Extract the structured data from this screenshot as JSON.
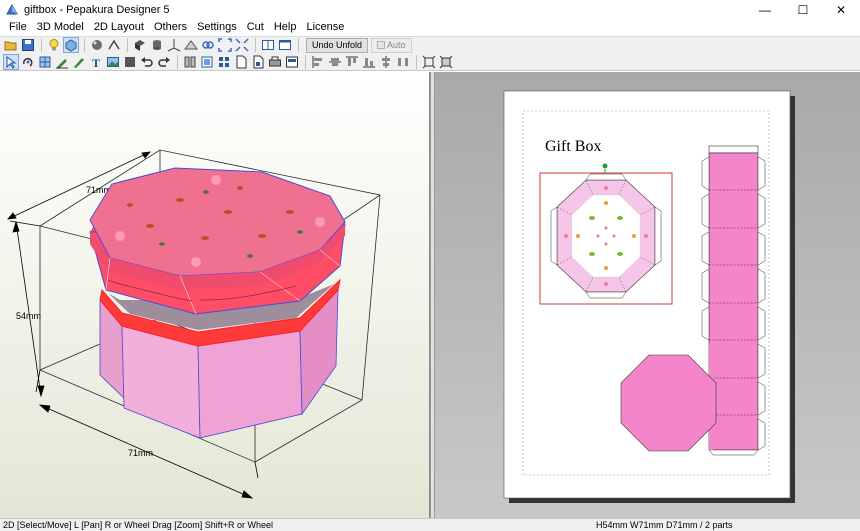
{
  "window": {
    "title": "giftbox - Pepakura Designer 5",
    "minimize_glyph": "—",
    "maximize_glyph": "☐",
    "close_glyph": "✕"
  },
  "menu": [
    "File",
    "3D Model",
    "2D Layout",
    "Others",
    "Settings",
    "Cut",
    "Help",
    "License"
  ],
  "toolbar1": {
    "undo_unfold_label": "Undo Unfold",
    "auto_label": "Auto",
    "icons": [
      "open-icon",
      "save-icon",
      "light-bulb-icon",
      "3d-view-icon",
      "texture-icon",
      "edge-icon",
      "cylinder-icon",
      "axis-icon",
      "plane-icon",
      "link-icon",
      "fit-icon",
      "zoom-icon",
      "split-view-icon",
      "single-view-icon"
    ]
  },
  "toolbar2": {
    "icons": [
      "select-icon",
      "rotate-icon",
      "select-parts-icon",
      "pencil-icon",
      "flap-icon",
      "text-icon",
      "image-icon",
      "grid-icon",
      "undo-icon",
      "redo-icon",
      "join-icon",
      "arrange-icon",
      "layout-icon",
      "page-icon",
      "print-icon",
      "export-icon",
      "align-left-icon",
      "align-center-icon",
      "align-top-icon",
      "align-bottom-icon",
      "align-middle-icon",
      "distribute-icon",
      "zoom-fit-icon",
      "zoom-all-icon"
    ]
  },
  "view3d": {
    "dim_top": "71mm",
    "dim_left": "54mm",
    "dim_bottom": "71mm",
    "colors": {
      "lid_top": "#f07090",
      "lid_side": "#f26a84",
      "body": "#f2a8d4",
      "outline": "#4a4ad8",
      "rim": "#ff2a2a"
    }
  },
  "view2d": {
    "page_title": "Gift Box",
    "colors": {
      "strip": "#f485cb",
      "octagon": "#f485cb",
      "selection": "#e03030",
      "lid_bg": "#f6c6e8"
    }
  },
  "status": {
    "left": "2D [Select/Move] L [Pan] R or Wheel Drag [Zoom] Shift+R or Wheel",
    "right": "H54mm W71mm D71mm / 2 parts"
  }
}
